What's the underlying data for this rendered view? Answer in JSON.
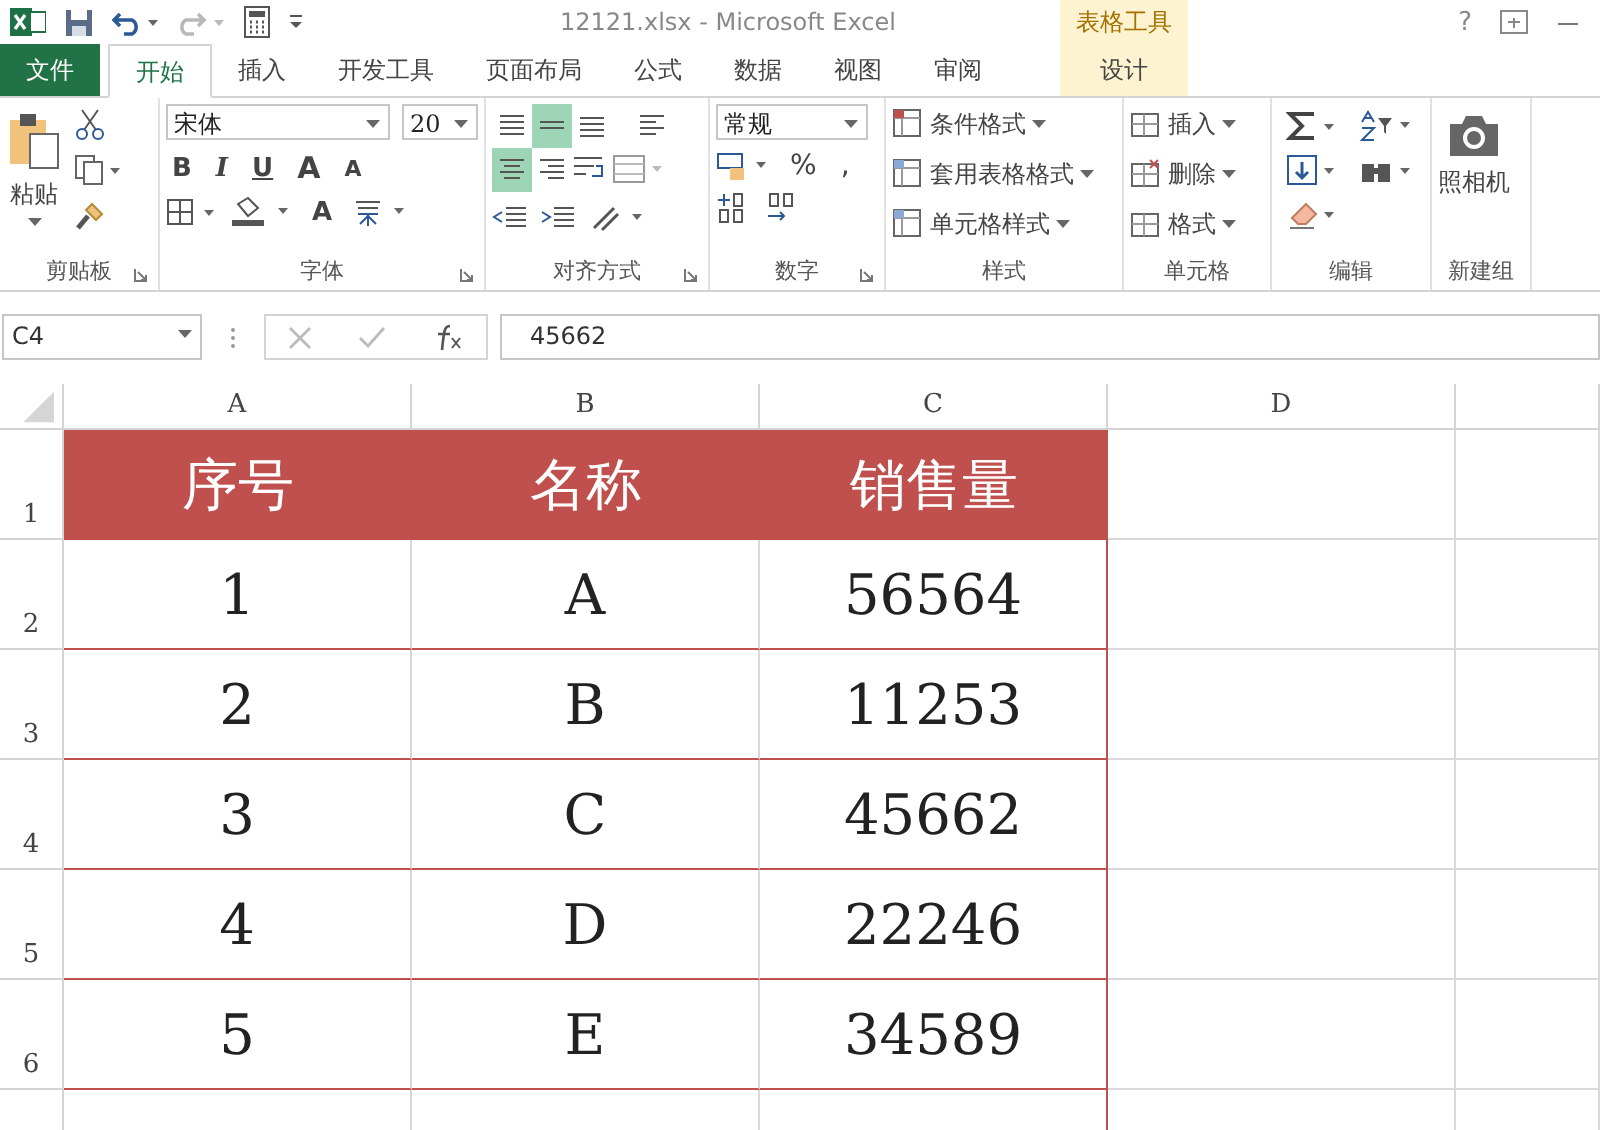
{
  "title_bar": {
    "title": "12121.xlsx - Microsoft Excel",
    "context_label": "表格工具",
    "help": "?"
  },
  "tabs": [
    {
      "label": "文件",
      "kind": "file",
      "selected": false
    },
    {
      "label": "开始",
      "kind": "normal",
      "selected": true
    },
    {
      "label": "插入",
      "kind": "normal",
      "selected": false
    },
    {
      "label": "开发工具",
      "kind": "normal",
      "selected": false
    },
    {
      "label": "页面布局",
      "kind": "normal",
      "selected": false
    },
    {
      "label": "公式",
      "kind": "normal",
      "selected": false
    },
    {
      "label": "数据",
      "kind": "normal",
      "selected": false
    },
    {
      "label": "视图",
      "kind": "normal",
      "selected": false
    },
    {
      "label": "审阅",
      "kind": "normal",
      "selected": false
    },
    {
      "label": "设计",
      "kind": "contextual",
      "selected": false
    }
  ],
  "ribbon": {
    "clipboard": {
      "paste": "粘贴",
      "label": "剪贴板"
    },
    "font": {
      "name": "宋体",
      "size": "20",
      "styles": [
        "B",
        "I",
        "U"
      ],
      "grow": "A",
      "shrink": "A",
      "font_color": "A",
      "label": "字体"
    },
    "alignment": {
      "buttons": [
        {
          "selected": false
        },
        {
          "selected": true
        },
        {
          "selected": false
        },
        {
          "selected": false
        },
        {
          "selected": true
        },
        {
          "selected": false
        }
      ],
      "label": "对齐方式"
    },
    "number": {
      "format": "常规",
      "percent": "%",
      "comma": ",",
      "label": "数字"
    },
    "styles": {
      "items": [
        "条件格式",
        "套用表格格式",
        "单元格样式"
      ],
      "label": "样式"
    },
    "cells": {
      "items": [
        "插入",
        "删除",
        "格式"
      ],
      "label": "单元格"
    },
    "editing": {
      "label": "编辑"
    },
    "custom": {
      "camera": "照相机",
      "label": "新建组"
    }
  },
  "formula_bar": {
    "name_box": "C4",
    "formula": "45662"
  },
  "sheet": {
    "columns": [
      "A",
      "B",
      "C",
      "D"
    ],
    "header": {
      "row": "1",
      "cells": [
        "序号",
        "名称",
        "销售量"
      ]
    },
    "rows": [
      {
        "row": "2",
        "cells": [
          "1",
          "A",
          "56564"
        ]
      },
      {
        "row": "3",
        "cells": [
          "2",
          "B",
          "11253"
        ]
      },
      {
        "row": "4",
        "cells": [
          "3",
          "C",
          "45662"
        ]
      },
      {
        "row": "5",
        "cells": [
          "4",
          "D",
          "22246"
        ]
      },
      {
        "row": "6",
        "cells": [
          "5",
          "E",
          "34589"
        ]
      }
    ]
  }
}
